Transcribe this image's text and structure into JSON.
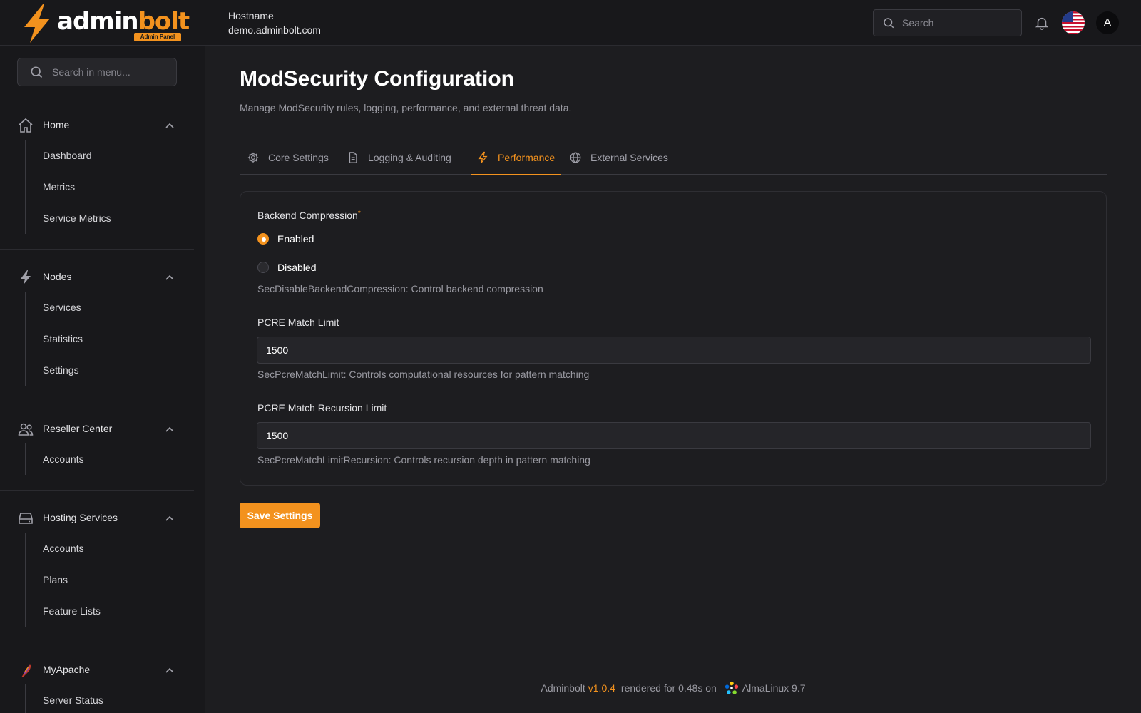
{
  "brand": {
    "part1": "admin",
    "part2": "bolt",
    "badge": "Admin Panel"
  },
  "header": {
    "hostname_label": "Hostname",
    "hostname_value": "demo.adminbolt.com",
    "search_placeholder": "Search",
    "avatar_initial": "A"
  },
  "sidebar": {
    "search_placeholder": "Search in menu...",
    "groups": [
      {
        "label": "Home",
        "icon": "home-icon",
        "items": [
          "Dashboard",
          "Metrics",
          "Service Metrics"
        ]
      },
      {
        "label": "Nodes",
        "icon": "bolt-icon",
        "items": [
          "Services",
          "Statistics",
          "Settings"
        ]
      },
      {
        "label": "Reseller Center",
        "icon": "users-icon",
        "items": [
          "Accounts"
        ]
      },
      {
        "label": "Hosting Services",
        "icon": "server-icon",
        "items": [
          "Accounts",
          "Plans",
          "Feature Lists"
        ]
      },
      {
        "label": "MyApache",
        "icon": "apache-feather-icon",
        "items": [
          "Server Status"
        ]
      }
    ]
  },
  "page": {
    "title": "ModSecurity Configuration",
    "subtitle": "Manage ModSecurity rules, logging, performance, and external threat data."
  },
  "tabs": [
    {
      "label": "Core Settings",
      "icon": "gear-icon",
      "active": false
    },
    {
      "label": "Logging & Auditing",
      "icon": "document-icon",
      "active": false
    },
    {
      "label": "Performance",
      "icon": "bolt-icon",
      "active": true
    },
    {
      "label": "External Services",
      "icon": "globe-icon",
      "active": false
    }
  ],
  "form": {
    "compression": {
      "label": "Backend Compression",
      "required_mark": "*",
      "options": [
        "Enabled",
        "Disabled"
      ],
      "selected": "Enabled",
      "help": "SecDisableBackendCompression: Control backend compression"
    },
    "pcre_limit": {
      "label": "PCRE Match Limit",
      "value": "1500",
      "help": "SecPcreMatchLimit: Controls computational resources for pattern matching"
    },
    "pcre_recursion": {
      "label": "PCRE Match Recursion Limit",
      "value": "1500",
      "help": "SecPcreMatchLimitRecursion: Controls recursion depth in pattern matching"
    },
    "save_label": "Save Settings"
  },
  "footer": {
    "product": "Adminbolt",
    "version": "v1.0.4",
    "rendered": "rendered for 0.48s on",
    "os": "AlmaLinux 9.7"
  },
  "colors": {
    "accent": "#f3921e",
    "background": "#1d1d20",
    "sidebar": "#18181b"
  }
}
